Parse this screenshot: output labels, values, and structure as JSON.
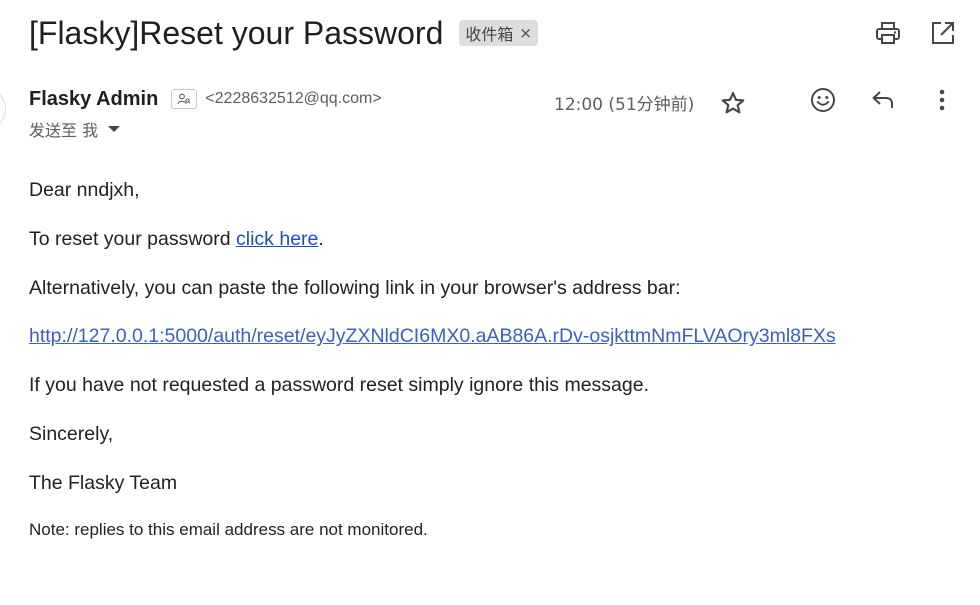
{
  "email": {
    "subject": "[Flasky]Reset your Password",
    "label_chip": "收件箱",
    "label_remove": "×",
    "sender_name": "Flasky Admin",
    "sender_email": "<2228632512@qq.com>",
    "recipients": "发送至 我",
    "time": "12:00 (51分钟前)"
  },
  "toolbar": {
    "icons": [
      "print-icon",
      "open-in-new-window-icon",
      "star-icon",
      "emoji-icon",
      "reply-icon",
      "more-vert-icon"
    ]
  },
  "body": {
    "greeting": "Dear nndjxh,",
    "reset_prefix": "To reset your password ",
    "reset_link": "click here",
    "reset_suffix": ".",
    "alternative": "Alternatively, you can paste the following link in your browser's address bar:",
    "reset_url": "http://127.0.0.1:5000/auth/reset/eyJyZXNldCI6MX0.aAB86A.rDv-osjkttmNmFLVAOry3ml8FXs",
    "ignore": "If you have not requested a password reset simply ignore this message.",
    "closing": "Sincerely,",
    "signature": "The Flasky Team",
    "note": "Note: replies to this email address are not monitored."
  },
  "colors": {
    "link": "#1a4fc4",
    "chip_bg": "#dddddd",
    "text": "#222222",
    "muted": "#5e5e5e"
  }
}
